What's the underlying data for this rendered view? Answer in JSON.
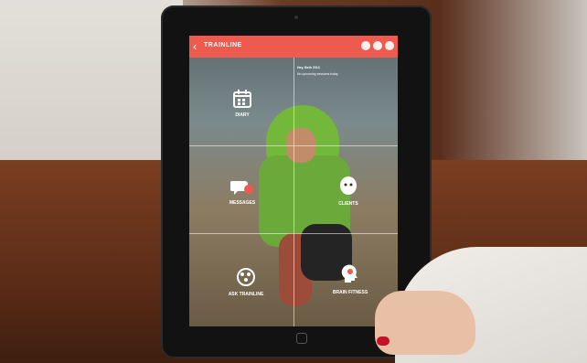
{
  "app": {
    "logo": "TRAINLINE",
    "back_glyph": "‹",
    "top_icons": [
      "gear-icon",
      "home-icon",
      "info-icon"
    ]
  },
  "screen": {
    "hint_title": "Hey, Beth 2013",
    "hint_sub": "No upcoming sessions today"
  },
  "tiles": [
    {
      "label": "DIARY",
      "icon": "calendar-icon"
    },
    {
      "label": "MESSAGES",
      "icon": "chat-bubbles-icon"
    },
    {
      "label": "CLIENTS",
      "icon": "client-face-icon"
    },
    {
      "label": "ASK TRAINLINE",
      "icon": "brain-icon"
    },
    {
      "label": "BRAIN FITNESS",
      "icon": "head-brain-icon"
    }
  ],
  "colors": {
    "accent": "#ef5a4e",
    "nail": "#c3122a",
    "hoodie": "#6aa93a"
  }
}
